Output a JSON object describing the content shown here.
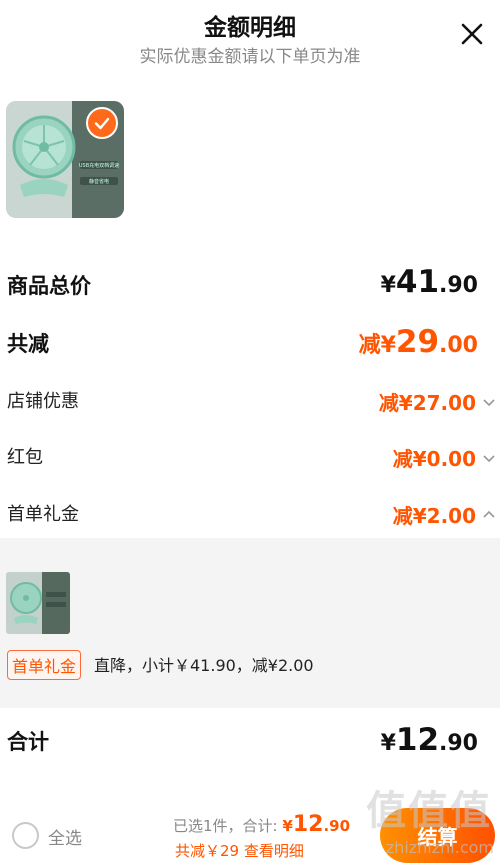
{
  "header": {
    "title": "金额明细",
    "subtitle": "实际优惠金额请以下单页为准"
  },
  "product": {
    "thumb_texts": [
      "USB充电双档调速",
      "静音省电"
    ]
  },
  "summary": {
    "total_label": "商品总价",
    "total_currency": "¥",
    "total_int": "41",
    "total_dec": ".90",
    "reduce_label": "共减",
    "reduce_prefix": "减¥",
    "reduce_int": "29",
    "reduce_dec": ".00"
  },
  "discounts": [
    {
      "label": "店铺优惠",
      "value": "减¥27.00",
      "expanded": false
    },
    {
      "label": "红包",
      "value": "减¥0.00",
      "expanded": false
    },
    {
      "label": "首单礼金",
      "value": "减¥2.00",
      "expanded": true
    }
  ],
  "detail": {
    "tag": "首单礼金",
    "desc": "直降，小计￥41.90，减¥2.00"
  },
  "sum": {
    "label": "合计",
    "currency": "¥",
    "int": "12",
    "dec": ".90"
  },
  "bottom": {
    "select_all": "全选",
    "selected_prefix": "已选1件，合计: ",
    "selected_currency": "¥",
    "selected_int": "12",
    "selected_dec": ".90",
    "reduce_text": "共减￥29  查看明细",
    "checkout": "结算"
  },
  "watermark": {
    "text": "值值值",
    "url": "zhizhizhi.com"
  },
  "colors": {
    "accent": "#ff5500",
    "checkout_gradient_start": "#ff9000",
    "checkout_gradient_end": "#ff5000"
  }
}
